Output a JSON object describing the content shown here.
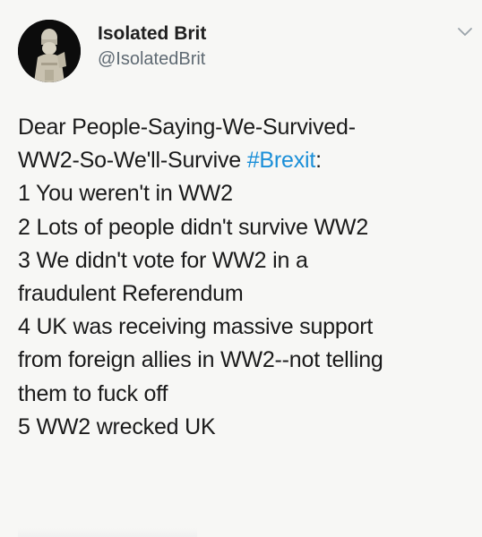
{
  "author": {
    "display_name": "Isolated Brit",
    "handle": "@IsolatedBrit",
    "avatar_icon": "chess-piece-avatar"
  },
  "menu": {
    "icon": "chevron-down-icon"
  },
  "tweet": {
    "line_1": "Dear People-Saying-We-Survived-",
    "line_2_text": "WW2-So-We'll-Survive ",
    "hashtag": "#Brexit",
    "line_2_suffix": ":",
    "line_3": "1 You weren't in WW2",
    "line_4": "2 Lots of people didn't survive WW2",
    "line_5": "3 We didn't vote for WW2 in a",
    "line_6": "fraudulent Referendum",
    "line_7": "4 UK was receiving massive support",
    "line_8": "from foreign allies in WW2--not telling",
    "line_9": "them to fuck off",
    "line_10": "5 WW2 wrecked UK"
  },
  "colors": {
    "background": "#f7f7f5",
    "hashtag": "#1b8fd8",
    "handle": "#5f6a73"
  }
}
